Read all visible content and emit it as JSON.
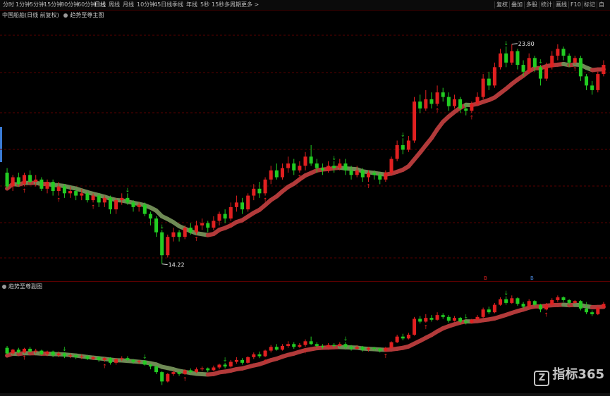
{
  "toolbar": {
    "left_items": [
      "分时",
      "1分钟",
      "5分钟",
      "15分钟",
      "30分钟",
      "60分钟",
      "日线",
      "周线",
      "月线",
      "10分钟",
      "45日线",
      "季线",
      "年线",
      "5秒",
      "15秒",
      "多周期",
      "更多 >"
    ],
    "active_index": 6,
    "right_items": [
      "复权",
      "叠加",
      "多股",
      "统计",
      "画线",
      "F10",
      "标记",
      "自"
    ]
  },
  "main_pane": {
    "title": "中国船舶(日线 前复权)",
    "indicator": "趋势至尊主图"
  },
  "sub_pane": {
    "indicator": "趋势至尊副图"
  },
  "marker_labels": {
    "red": "B",
    "blue": "B"
  },
  "watermark": {
    "logo_char": "Z",
    "text": "指标365"
  },
  "colors": {
    "up": "#e02020",
    "down": "#22cc22",
    "ma_up": "#b23a3a",
    "ma_down": "#6f8a55",
    "grid": "#5a0000",
    "background": "#000000"
  },
  "chart_data": [
    {
      "type": "candlestick",
      "title": "中国船舶(日线 前复权)",
      "annotations": {
        "high_label": "23.80",
        "low_label": "14.22"
      },
      "price_range": [
        13.9,
        24.5
      ],
      "grid": true,
      "candles": [
        [
          18.2,
          17.6,
          18.4,
          17.5
        ],
        [
          17.6,
          18.0,
          18.1,
          17.4
        ],
        [
          18.0,
          17.7,
          18.2,
          17.6
        ],
        [
          17.7,
          18.1,
          18.2,
          17.6
        ],
        [
          18.1,
          17.8,
          18.3,
          17.7
        ],
        [
          17.8,
          17.9,
          18.1,
          17.6
        ],
        [
          17.9,
          17.5,
          18.0,
          17.4
        ],
        [
          17.5,
          17.8,
          17.9,
          17.3
        ],
        [
          17.8,
          17.4,
          17.9,
          17.2
        ],
        [
          17.4,
          17.6,
          17.8,
          17.2
        ],
        [
          17.6,
          17.3,
          17.7,
          17.1
        ],
        [
          17.3,
          17.4,
          17.6,
          17.1
        ],
        [
          17.4,
          17.2,
          17.5,
          17.0
        ],
        [
          17.2,
          17.3,
          17.5,
          17.0
        ],
        [
          17.3,
          17.0,
          17.4,
          16.9
        ],
        [
          17.0,
          17.2,
          17.3,
          16.9
        ],
        [
          17.2,
          16.9,
          17.3,
          16.7
        ],
        [
          16.9,
          17.1,
          17.2,
          16.7
        ],
        [
          17.1,
          16.6,
          17.2,
          16.4
        ],
        [
          16.6,
          17.0,
          17.1,
          16.4
        ],
        [
          17.0,
          17.1,
          17.3,
          16.8
        ],
        [
          17.1,
          16.9,
          17.3,
          16.8
        ],
        [
          16.9,
          16.7,
          17.0,
          16.5
        ],
        [
          16.7,
          16.8,
          16.9,
          16.5
        ],
        [
          16.8,
          16.4,
          16.9,
          16.3
        ],
        [
          16.4,
          16.2,
          16.5,
          15.9
        ],
        [
          16.2,
          15.6,
          16.3,
          15.4
        ],
        [
          15.6,
          14.6,
          15.7,
          14.22
        ],
        [
          14.6,
          15.4,
          15.5,
          14.5
        ],
        [
          15.4,
          15.6,
          15.8,
          15.2
        ],
        [
          15.6,
          15.4,
          15.7,
          15.2
        ],
        [
          15.4,
          15.8,
          15.9,
          15.3
        ],
        [
          15.8,
          15.6,
          16.0,
          15.5
        ],
        [
          15.6,
          15.9,
          16.1,
          15.5
        ],
        [
          15.9,
          16.0,
          16.2,
          15.7
        ],
        [
          16.0,
          15.8,
          16.1,
          15.6
        ],
        [
          15.8,
          16.1,
          16.3,
          15.7
        ],
        [
          16.1,
          16.4,
          16.5,
          15.9
        ],
        [
          16.4,
          16.2,
          16.6,
          16.0
        ],
        [
          16.2,
          16.7,
          16.9,
          16.1
        ],
        [
          16.7,
          16.9,
          17.2,
          16.5
        ],
        [
          16.9,
          16.6,
          17.1,
          16.4
        ],
        [
          16.6,
          17.2,
          17.3,
          16.5
        ],
        [
          17.2,
          17.5,
          17.7,
          17.0
        ],
        [
          17.5,
          17.3,
          17.8,
          17.1
        ],
        [
          17.3,
          17.9,
          18.0,
          17.2
        ],
        [
          17.9,
          18.3,
          18.5,
          17.7
        ],
        [
          18.3,
          18.0,
          18.6,
          17.9
        ],
        [
          18.0,
          18.4,
          18.6,
          17.9
        ],
        [
          18.4,
          18.6,
          18.9,
          18.2
        ],
        [
          18.6,
          18.3,
          18.8,
          18.1
        ],
        [
          18.3,
          18.5,
          18.7,
          18.2
        ],
        [
          18.5,
          18.9,
          19.1,
          18.3
        ],
        [
          18.9,
          18.6,
          19.4,
          18.5
        ],
        [
          18.6,
          18.4,
          18.8,
          18.2
        ],
        [
          18.4,
          18.3,
          18.6,
          18.1
        ],
        [
          18.3,
          18.5,
          18.7,
          18.2
        ],
        [
          18.5,
          18.4,
          18.7,
          18.2
        ],
        [
          18.4,
          18.6,
          18.8,
          18.3
        ],
        [
          18.6,
          18.3,
          18.8,
          18.1
        ],
        [
          18.3,
          18.1,
          18.5,
          17.9
        ],
        [
          18.1,
          18.3,
          18.5,
          18.0
        ],
        [
          18.3,
          18.0,
          18.4,
          17.8
        ],
        [
          18.0,
          18.2,
          18.3,
          17.8
        ],
        [
          18.2,
          18.1,
          18.3,
          17.9
        ],
        [
          18.1,
          17.9,
          18.2,
          17.7
        ],
        [
          17.9,
          18.2,
          18.3,
          17.8
        ],
        [
          18.2,
          18.8,
          18.9,
          18.1
        ],
        [
          18.8,
          19.4,
          19.6,
          18.7
        ],
        [
          19.4,
          19.2,
          19.7,
          19.0
        ],
        [
          19.2,
          19.6,
          19.8,
          19.1
        ],
        [
          19.6,
          21.3,
          21.5,
          19.5
        ],
        [
          21.3,
          21.0,
          21.6,
          20.8
        ],
        [
          21.0,
          21.4,
          21.8,
          20.9
        ],
        [
          21.4,
          21.2,
          21.7,
          21.0
        ],
        [
          21.2,
          21.7,
          22.0,
          21.1
        ],
        [
          21.7,
          21.5,
          21.9,
          21.3
        ],
        [
          21.5,
          21.1,
          21.7,
          20.9
        ],
        [
          21.1,
          21.4,
          21.6,
          21.0
        ],
        [
          21.4,
          21.0,
          21.5,
          20.8
        ],
        [
          21.0,
          20.9,
          21.2,
          20.7
        ],
        [
          20.9,
          21.2,
          21.3,
          20.8
        ],
        [
          21.2,
          21.5,
          21.7,
          21.1
        ],
        [
          21.5,
          22.3,
          22.5,
          21.4
        ],
        [
          22.3,
          22.0,
          22.6,
          21.8
        ],
        [
          22.0,
          22.8,
          23.0,
          21.9
        ],
        [
          22.8,
          23.4,
          23.6,
          22.7
        ],
        [
          23.4,
          23.0,
          23.7,
          22.8
        ],
        [
          23.0,
          23.5,
          23.8,
          22.9
        ],
        [
          23.5,
          22.9,
          23.6,
          22.7
        ],
        [
          22.9,
          22.6,
          23.1,
          22.4
        ],
        [
          22.6,
          23.2,
          23.4,
          22.5
        ],
        [
          23.2,
          22.8,
          23.3,
          22.6
        ],
        [
          22.8,
          22.3,
          22.9,
          22.0
        ],
        [
          22.3,
          22.8,
          23.0,
          22.2
        ],
        [
          22.8,
          23.3,
          23.5,
          22.7
        ],
        [
          23.3,
          23.6,
          23.8,
          23.1
        ],
        [
          23.6,
          23.3,
          23.7,
          23.1
        ],
        [
          23.3,
          23.0,
          23.4,
          22.8
        ],
        [
          23.0,
          23.2,
          23.3,
          22.9
        ],
        [
          23.2,
          22.4,
          23.3,
          22.2
        ],
        [
          22.4,
          22.0,
          22.5,
          21.8
        ],
        [
          22.0,
          21.8,
          22.2,
          21.6
        ],
        [
          21.8,
          22.5,
          22.6,
          21.7
        ],
        [
          22.5,
          22.9,
          23.1,
          22.4
        ]
      ]
    },
    {
      "type": "candlestick",
      "title": "趋势至尊副图",
      "price_range": [
        13.8,
        24.5
      ],
      "grid": false
    }
  ]
}
